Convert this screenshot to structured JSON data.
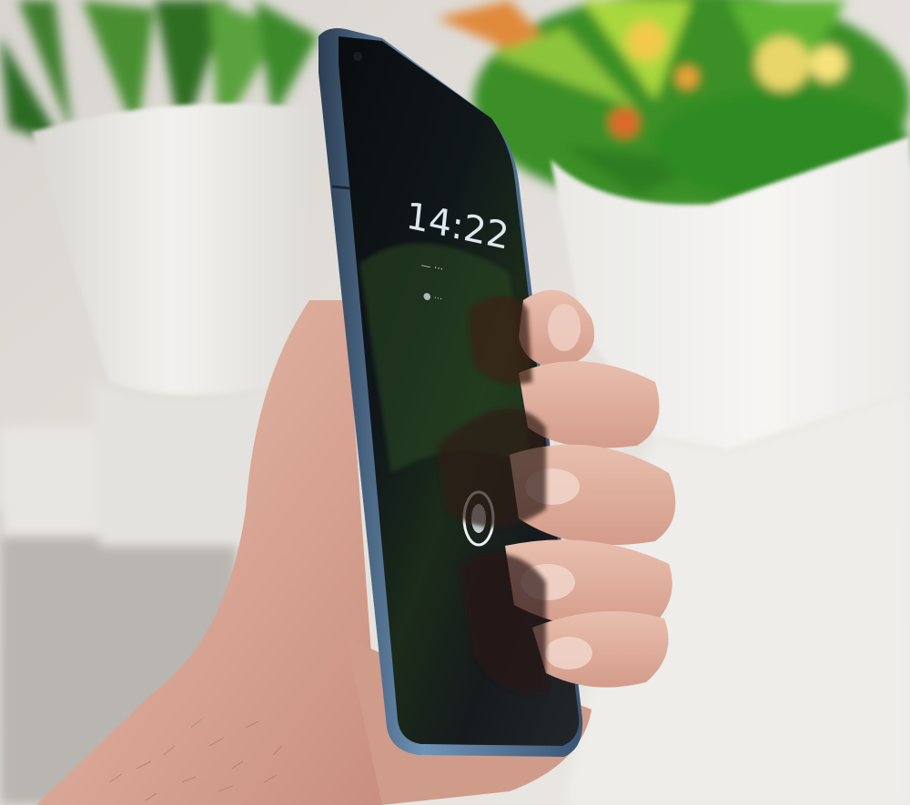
{
  "photo": {
    "subject": "phone-in-hand",
    "colors": {
      "background": "#cfcac3",
      "pot": "#ecebe8",
      "plant_green": "#3c9b2a",
      "phone_frame": "#5b7fa0",
      "screen": "#0c1012",
      "skin": "#d9a998"
    }
  },
  "lock_screen": {
    "time": "14:22",
    "date": "— ···",
    "status": "● ···",
    "fingerprint_icon": "fingerprint-icon"
  }
}
